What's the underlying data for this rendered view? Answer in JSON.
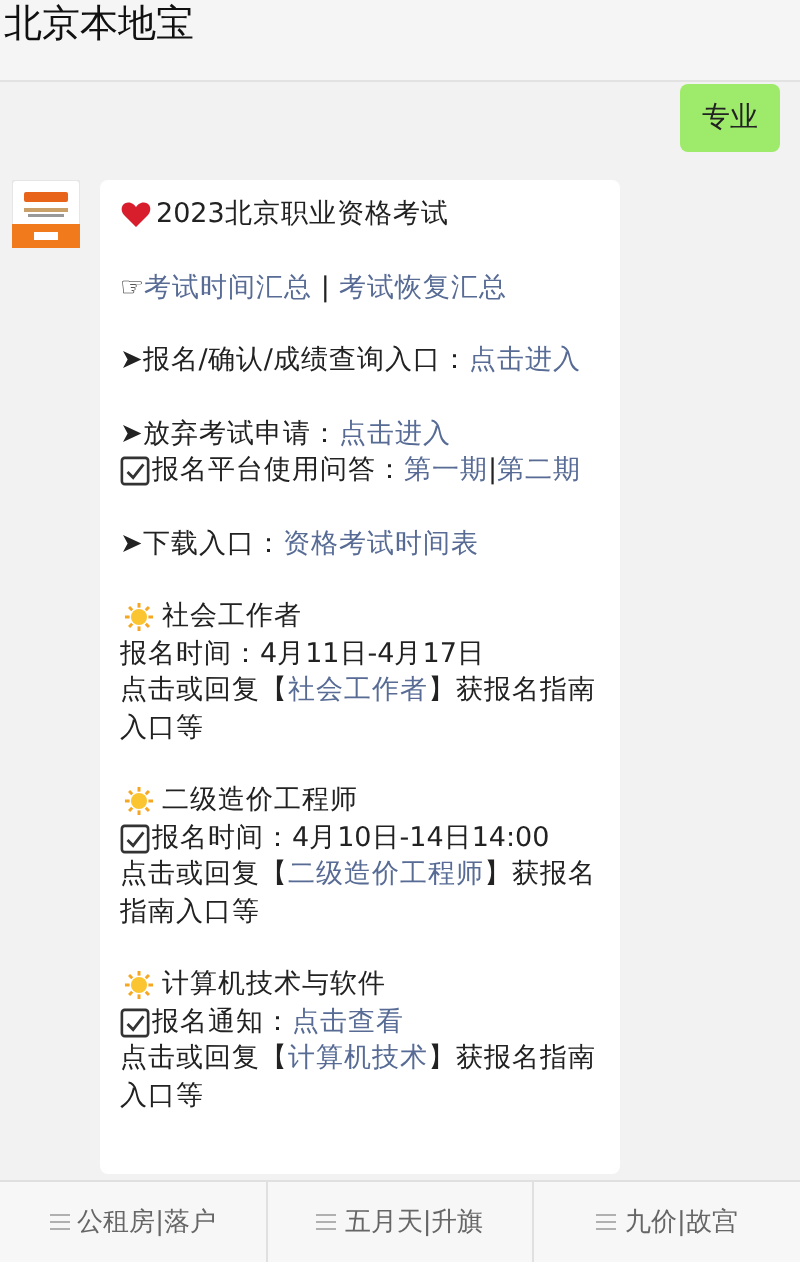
{
  "header": {
    "title": "北京本地宝"
  },
  "user_message": {
    "text": "专业"
  },
  "bot_message": {
    "title": "2023北京职业资格考试",
    "paragraphs": [
      {
        "lines": [
          {
            "kind": "plain",
            "segments": [
              {
                "text": "☞",
                "link": false
              },
              {
                "text": "考试时间汇总",
                "link": true
              },
              {
                "text": " | ",
                "link": false
              },
              {
                "text": "考试恢复汇总",
                "link": true
              }
            ]
          }
        ]
      },
      {
        "lines": [
          {
            "kind": "plain",
            "segments": [
              {
                "text": "➤报名/确认/成绩查询入口：",
                "link": false
              },
              {
                "text": "点击进入",
                "link": true
              }
            ]
          }
        ]
      },
      {
        "lines": [
          {
            "kind": "plain",
            "segments": [
              {
                "text": "➤放弃考试申请：",
                "link": false
              },
              {
                "text": "点击进入",
                "link": true
              }
            ]
          },
          {
            "kind": "check",
            "segments": [
              {
                "text": "报名平台使用问答：",
                "link": false
              },
              {
                "text": "第一期",
                "link": true
              },
              {
                "text": "|",
                "link": false
              },
              {
                "text": "第二期",
                "link": true
              }
            ]
          }
        ]
      },
      {
        "lines": [
          {
            "kind": "plain",
            "segments": [
              {
                "text": "➤下载入口：",
                "link": false
              },
              {
                "text": "资格考试时间表",
                "link": true
              }
            ]
          }
        ]
      },
      {
        "lines": [
          {
            "kind": "sun",
            "segments": [
              {
                "text": "社会工作者",
                "link": false
              }
            ]
          },
          {
            "kind": "plain",
            "segments": [
              {
                "text": "报名时间：4月11日-4月17日",
                "link": false
              }
            ]
          },
          {
            "kind": "plain",
            "segments": [
              {
                "text": "点击或回复【",
                "link": false
              },
              {
                "text": "社会工作者",
                "link": true
              },
              {
                "text": "】获报名指南入口等",
                "link": false
              }
            ]
          }
        ]
      },
      {
        "lines": [
          {
            "kind": "sun",
            "segments": [
              {
                "text": "二级造价工程师",
                "link": false
              }
            ]
          },
          {
            "kind": "check",
            "segments": [
              {
                "text": "报名时间：4月10日-14日14:00",
                "link": false
              }
            ]
          },
          {
            "kind": "plain",
            "segments": [
              {
                "text": "点击或回复【",
                "link": false
              },
              {
                "text": "二级造价工程师",
                "link": true
              },
              {
                "text": "】获报名指南入口等",
                "link": false
              }
            ]
          }
        ]
      },
      {
        "lines": [
          {
            "kind": "sun",
            "segments": [
              {
                "text": "计算机技术与软件",
                "link": false
              }
            ]
          },
          {
            "kind": "check",
            "segments": [
              {
                "text": "报名通知：",
                "link": false
              },
              {
                "text": "点击查看",
                "link": true
              }
            ]
          },
          {
            "kind": "plain",
            "segments": [
              {
                "text": "点击或回复【",
                "link": false
              },
              {
                "text": "计算机技术",
                "link": true
              },
              {
                "text": "】获报名指南入口等",
                "link": false
              }
            ]
          }
        ]
      }
    ]
  },
  "menu": [
    {
      "label": "公租房|落户"
    },
    {
      "label": "五月天|升旗"
    },
    {
      "label": "九价|故宫"
    }
  ]
}
